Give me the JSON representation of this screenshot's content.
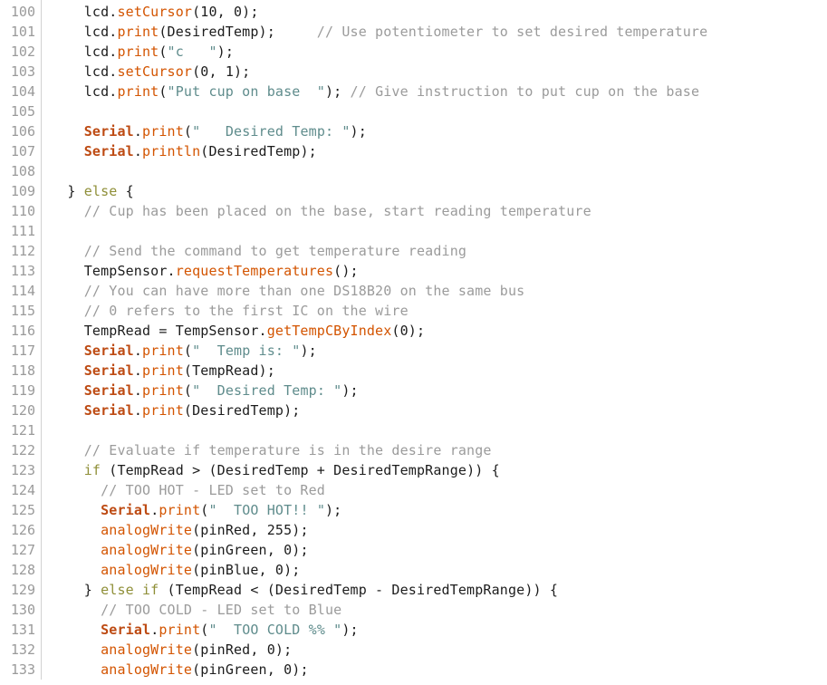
{
  "editor": {
    "name": "arduino-code-editor",
    "background": "#ffffff",
    "gutter_background": "#ffffff",
    "gutter_divider_color": "#d2d2d2",
    "line_number_color": "#9a9a9a",
    "first_line_number": 100,
    "last_line_number": 133,
    "line_height_px": 22,
    "font_size_px": 15,
    "colors": {
      "plain": "#1c1c1c",
      "comment": "#9b9b9b",
      "string": "#5f8c8c",
      "function": "#d35400",
      "object": "#bd4a12",
      "keyword": "#8f8f38"
    }
  },
  "lines": [
    {
      "n": "100",
      "tokens": [
        {
          "t": "plain",
          "s": "    lcd."
        },
        {
          "t": "func",
          "s": "setCursor"
        },
        {
          "t": "plain",
          "s": "(10, 0);"
        }
      ]
    },
    {
      "n": "101",
      "tokens": [
        {
          "t": "plain",
          "s": "    lcd."
        },
        {
          "t": "func",
          "s": "print"
        },
        {
          "t": "plain",
          "s": "(DesiredTemp);     "
        },
        {
          "t": "comment",
          "s": "// Use potentiometer to set desired temperature"
        }
      ]
    },
    {
      "n": "102",
      "tokens": [
        {
          "t": "plain",
          "s": "    lcd."
        },
        {
          "t": "func",
          "s": "print"
        },
        {
          "t": "plain",
          "s": "("
        },
        {
          "t": "string",
          "s": "\"c   \""
        },
        {
          "t": "plain",
          "s": ");"
        }
      ]
    },
    {
      "n": "103",
      "tokens": [
        {
          "t": "plain",
          "s": "    lcd."
        },
        {
          "t": "func",
          "s": "setCursor"
        },
        {
          "t": "plain",
          "s": "(0, 1);"
        }
      ]
    },
    {
      "n": "104",
      "tokens": [
        {
          "t": "plain",
          "s": "    lcd."
        },
        {
          "t": "func",
          "s": "print"
        },
        {
          "t": "plain",
          "s": "("
        },
        {
          "t": "string",
          "s": "\"Put cup on base  \""
        },
        {
          "t": "plain",
          "s": "); "
        },
        {
          "t": "comment",
          "s": "// Give instruction to put cup on the base"
        }
      ]
    },
    {
      "n": "105",
      "tokens": []
    },
    {
      "n": "106",
      "tokens": [
        {
          "t": "plain",
          "s": "    "
        },
        {
          "t": "obj",
          "s": "Serial"
        },
        {
          "t": "plain",
          "s": "."
        },
        {
          "t": "func",
          "s": "print"
        },
        {
          "t": "plain",
          "s": "("
        },
        {
          "t": "string",
          "s": "\"   Desired Temp: \""
        },
        {
          "t": "plain",
          "s": ");"
        }
      ]
    },
    {
      "n": "107",
      "tokens": [
        {
          "t": "plain",
          "s": "    "
        },
        {
          "t": "obj",
          "s": "Serial"
        },
        {
          "t": "plain",
          "s": "."
        },
        {
          "t": "func",
          "s": "println"
        },
        {
          "t": "plain",
          "s": "(DesiredTemp);"
        }
      ]
    },
    {
      "n": "108",
      "tokens": []
    },
    {
      "n": "109",
      "tokens": [
        {
          "t": "plain",
          "s": "  } "
        },
        {
          "t": "kw",
          "s": "else"
        },
        {
          "t": "plain",
          "s": " {"
        }
      ]
    },
    {
      "n": "110",
      "tokens": [
        {
          "t": "plain",
          "s": "    "
        },
        {
          "t": "comment",
          "s": "// Cup has been placed on the base, start reading temperature"
        }
      ]
    },
    {
      "n": "111",
      "tokens": []
    },
    {
      "n": "112",
      "tokens": [
        {
          "t": "plain",
          "s": "    "
        },
        {
          "t": "comment",
          "s": "// Send the command to get temperature reading"
        }
      ]
    },
    {
      "n": "113",
      "tokens": [
        {
          "t": "plain",
          "s": "    TempSensor."
        },
        {
          "t": "func",
          "s": "requestTemperatures"
        },
        {
          "t": "plain",
          "s": "();"
        }
      ]
    },
    {
      "n": "114",
      "tokens": [
        {
          "t": "plain",
          "s": "    "
        },
        {
          "t": "comment",
          "s": "// You can have more than one DS18B20 on the same bus"
        }
      ]
    },
    {
      "n": "115",
      "tokens": [
        {
          "t": "plain",
          "s": "    "
        },
        {
          "t": "comment",
          "s": "// 0 refers to the first IC on the wire"
        }
      ]
    },
    {
      "n": "116",
      "tokens": [
        {
          "t": "plain",
          "s": "    TempRead = TempSensor."
        },
        {
          "t": "func",
          "s": "getTempCByIndex"
        },
        {
          "t": "plain",
          "s": "(0);"
        }
      ]
    },
    {
      "n": "117",
      "tokens": [
        {
          "t": "plain",
          "s": "    "
        },
        {
          "t": "obj",
          "s": "Serial"
        },
        {
          "t": "plain",
          "s": "."
        },
        {
          "t": "func",
          "s": "print"
        },
        {
          "t": "plain",
          "s": "("
        },
        {
          "t": "string",
          "s": "\"  Temp is: \""
        },
        {
          "t": "plain",
          "s": ");"
        }
      ]
    },
    {
      "n": "118",
      "tokens": [
        {
          "t": "plain",
          "s": "    "
        },
        {
          "t": "obj",
          "s": "Serial"
        },
        {
          "t": "plain",
          "s": "."
        },
        {
          "t": "func",
          "s": "print"
        },
        {
          "t": "plain",
          "s": "(TempRead);"
        }
      ]
    },
    {
      "n": "119",
      "tokens": [
        {
          "t": "plain",
          "s": "    "
        },
        {
          "t": "obj",
          "s": "Serial"
        },
        {
          "t": "plain",
          "s": "."
        },
        {
          "t": "func",
          "s": "print"
        },
        {
          "t": "plain",
          "s": "("
        },
        {
          "t": "string",
          "s": "\"  Desired Temp: \""
        },
        {
          "t": "plain",
          "s": ");"
        }
      ]
    },
    {
      "n": "120",
      "tokens": [
        {
          "t": "plain",
          "s": "    "
        },
        {
          "t": "obj",
          "s": "Serial"
        },
        {
          "t": "plain",
          "s": "."
        },
        {
          "t": "func",
          "s": "print"
        },
        {
          "t": "plain",
          "s": "(DesiredTemp);"
        }
      ]
    },
    {
      "n": "121",
      "tokens": []
    },
    {
      "n": "122",
      "tokens": [
        {
          "t": "plain",
          "s": "    "
        },
        {
          "t": "comment",
          "s": "// Evaluate if temperature is in the desire range"
        }
      ]
    },
    {
      "n": "123",
      "tokens": [
        {
          "t": "plain",
          "s": "    "
        },
        {
          "t": "kw",
          "s": "if"
        },
        {
          "t": "plain",
          "s": " (TempRead > (DesiredTemp + DesiredTempRange)) {"
        }
      ]
    },
    {
      "n": "124",
      "tokens": [
        {
          "t": "plain",
          "s": "      "
        },
        {
          "t": "comment",
          "s": "// TOO HOT - LED set to Red"
        }
      ]
    },
    {
      "n": "125",
      "tokens": [
        {
          "t": "plain",
          "s": "      "
        },
        {
          "t": "obj",
          "s": "Serial"
        },
        {
          "t": "plain",
          "s": "."
        },
        {
          "t": "func",
          "s": "print"
        },
        {
          "t": "plain",
          "s": "("
        },
        {
          "t": "string",
          "s": "\"  TOO HOT!! \""
        },
        {
          "t": "plain",
          "s": ");"
        }
      ]
    },
    {
      "n": "126",
      "tokens": [
        {
          "t": "plain",
          "s": "      "
        },
        {
          "t": "func",
          "s": "analogWrite"
        },
        {
          "t": "plain",
          "s": "(pinRed, 255);"
        }
      ]
    },
    {
      "n": "127",
      "tokens": [
        {
          "t": "plain",
          "s": "      "
        },
        {
          "t": "func",
          "s": "analogWrite"
        },
        {
          "t": "plain",
          "s": "(pinGreen, 0);"
        }
      ]
    },
    {
      "n": "128",
      "tokens": [
        {
          "t": "plain",
          "s": "      "
        },
        {
          "t": "func",
          "s": "analogWrite"
        },
        {
          "t": "plain",
          "s": "(pinBlue, 0);"
        }
      ]
    },
    {
      "n": "129",
      "tokens": [
        {
          "t": "plain",
          "s": "    } "
        },
        {
          "t": "kw",
          "s": "else if"
        },
        {
          "t": "plain",
          "s": " (TempRead < (DesiredTemp - DesiredTempRange)) {"
        }
      ]
    },
    {
      "n": "130",
      "tokens": [
        {
          "t": "plain",
          "s": "      "
        },
        {
          "t": "comment",
          "s": "// TOO COLD - LED set to Blue"
        }
      ]
    },
    {
      "n": "131",
      "tokens": [
        {
          "t": "plain",
          "s": "      "
        },
        {
          "t": "obj",
          "s": "Serial"
        },
        {
          "t": "plain",
          "s": "."
        },
        {
          "t": "func",
          "s": "print"
        },
        {
          "t": "plain",
          "s": "("
        },
        {
          "t": "string",
          "s": "\"  TOO COLD %% \""
        },
        {
          "t": "plain",
          "s": ");"
        }
      ]
    },
    {
      "n": "132",
      "tokens": [
        {
          "t": "plain",
          "s": "      "
        },
        {
          "t": "func",
          "s": "analogWrite"
        },
        {
          "t": "plain",
          "s": "(pinRed, 0);"
        }
      ]
    },
    {
      "n": "133",
      "tokens": [
        {
          "t": "plain",
          "s": "      "
        },
        {
          "t": "func",
          "s": "analogWrite"
        },
        {
          "t": "plain",
          "s": "(pinGreen, 0);"
        }
      ]
    }
  ]
}
